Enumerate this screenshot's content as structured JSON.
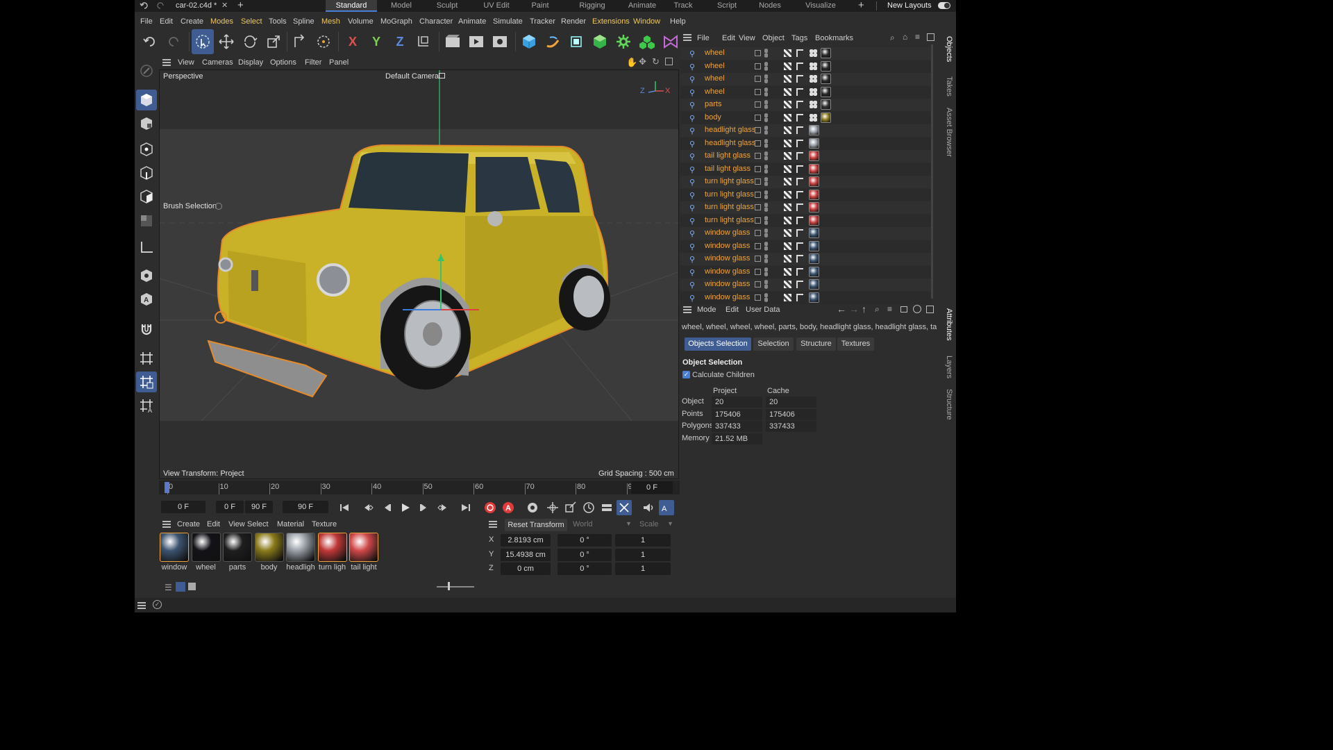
{
  "layoutbar": {
    "doc_title": "car-02.c4d *",
    "tabs": [
      "Standard",
      "Model",
      "Sculpt",
      "UV Edit",
      "Paint",
      "Rigging",
      "Animate",
      "Track",
      "Script",
      "Nodes",
      "Visualize"
    ],
    "active_tab": "Standard",
    "new_layouts": "New Layouts"
  },
  "menubar": [
    "File",
    "Edit",
    "Create",
    "Modes",
    "Select",
    "Tools",
    "Spline",
    "Mesh",
    "Volume",
    "MoGraph",
    "Character",
    "Animate",
    "Simulate",
    "Tracker",
    "Render",
    "Extensions",
    "Window",
    "Help"
  ],
  "menubar_highlight": [
    "Modes",
    "Select",
    "Mesh",
    "Extensions",
    "Window"
  ],
  "toolbar_icons": [
    "undo-icon",
    "redo-icon",
    "live-selection-icon",
    "move-icon",
    "rotate-icon",
    "scale-icon",
    "transfer-icon",
    "dynamic-place-icon",
    "x-axis-icon",
    "y-axis-icon",
    "z-axis-icon",
    "coordinate-system-icon",
    "render-view-icon",
    "render-picture-viewer-icon",
    "render-settings-icon",
    "cube-icon",
    "bend-icon",
    "subdivide-icon",
    "polygon-icon",
    "cloner-icon",
    "generator-icon",
    "spline-pen-icon"
  ],
  "toolbar_axis_labels": [
    "X",
    "Y",
    "Z"
  ],
  "left_tools": [
    "brush-icon",
    "model-mode-icon",
    "texture-mode-icon",
    "point-mode-icon",
    "edge-mode-icon",
    "polygon-mode-icon",
    "uv-mode-icon",
    "axis-mode-icon",
    "solo-icon",
    "auto-snap-icon",
    "magnet-icon",
    "workplane-icon",
    "grid-snap-icon",
    "quantize-icon"
  ],
  "viewport": {
    "menu": [
      "View",
      "Cameras",
      "Display",
      "Options",
      "Filter",
      "Panel"
    ],
    "projection": "Perspective",
    "camera": "Default Camera",
    "brush_selection": "Brush Selection",
    "view_transform": "View Transform: Project",
    "grid_spacing": "Grid Spacing : 500 cm",
    "axis_z": "Z",
    "axis_x": "X"
  },
  "timeline": {
    "ticks": [
      "0",
      "10",
      "20",
      "30",
      "40",
      "50",
      "60",
      "70",
      "80",
      "90"
    ],
    "current_frame_display": "0 F",
    "frame_field": "0 F",
    "range_start": "0 F",
    "range_end": "90 F",
    "range_end2": "90 F"
  },
  "materials": {
    "menu": [
      "Create",
      "Edit",
      "View",
      "Select",
      "Material",
      "Texture"
    ],
    "items": [
      {
        "label": "window",
        "color": "#3c5470"
      },
      {
        "label": "wheel",
        "color": "#121218"
      },
      {
        "label": "parts",
        "color": "#1e1e1e"
      },
      {
        "label": "body",
        "color": "#8a7a1a"
      },
      {
        "label": "headligh",
        "color": "#9aa0a8"
      },
      {
        "label": "turn ligh",
        "color": "#c03838"
      },
      {
        "label": "tail light",
        "color": "#d04848"
      }
    ]
  },
  "coords": {
    "reset_transform": "Reset Transform",
    "space": "World",
    "scale_mode": "Scale",
    "rows": [
      {
        "axis": "X",
        "pos": "2.8193 cm",
        "rot": "0 °",
        "scale": "1"
      },
      {
        "axis": "Y",
        "pos": "15.4938 cm",
        "rot": "0 °",
        "scale": "1"
      },
      {
        "axis": "Z",
        "pos": "0 cm",
        "rot": "0 °",
        "scale": "1"
      }
    ]
  },
  "object_manager": {
    "menu": [
      "File",
      "Edit",
      "View",
      "Object",
      "Tags",
      "Bookmarks"
    ],
    "objects": [
      {
        "name": "wheel",
        "tag": "#2a2a2a"
      },
      {
        "name": "wheel",
        "tag": "#2a2a2a"
      },
      {
        "name": "wheel",
        "tag": "#2a2a2a"
      },
      {
        "name": "wheel",
        "tag": "#2a2a2a"
      },
      {
        "name": "parts",
        "tag": "#333"
      },
      {
        "name": "body",
        "tag": "#8a7a1a"
      },
      {
        "name": "headlight glass",
        "tag": "#9aa0a8"
      },
      {
        "name": "headlight glass",
        "tag": "#9aa0a8"
      },
      {
        "name": "tail light glass",
        "tag": "#c94040"
      },
      {
        "name": "tail light glass",
        "tag": "#c94040"
      },
      {
        "name": "turn light glass",
        "tag": "#c94040"
      },
      {
        "name": "turn light glass",
        "tag": "#c94040"
      },
      {
        "name": "turn light glass",
        "tag": "#c94040"
      },
      {
        "name": "turn light glass",
        "tag": "#c94040"
      },
      {
        "name": "window glass",
        "tag": "#3c5470"
      },
      {
        "name": "window glass",
        "tag": "#3c5470"
      },
      {
        "name": "window glass",
        "tag": "#3c5470"
      },
      {
        "name": "window glass",
        "tag": "#3c5470"
      },
      {
        "name": "window glass",
        "tag": "#3c5470"
      },
      {
        "name": "window glass",
        "tag": "#3c5470"
      }
    ]
  },
  "attributes": {
    "menu": [
      "Mode",
      "Edit",
      "User Data"
    ],
    "selection_summary": "wheel, wheel, wheel, wheel, parts, body, headlight glass, headlight glass, tail light",
    "tabs": [
      "Objects Selection",
      "Selection",
      "Structure",
      "Textures"
    ],
    "section_title": "Object Selection",
    "calculate_children": "Calculate Children",
    "col_project": "Project",
    "col_cache": "Cache",
    "rows": [
      {
        "label": "Object",
        "project": "20",
        "cache": "20"
      },
      {
        "label": "Points",
        "project": "175406",
        "cache": "175406"
      },
      {
        "label": "Polygons",
        "project": "337433",
        "cache": "337433"
      },
      {
        "label": "Memory",
        "project": "21.52 MB",
        "cache": ""
      }
    ]
  },
  "side_tabs": [
    "Objects",
    "Takes",
    "Asset Browser",
    "Attributes",
    "Layers",
    "Structure"
  ],
  "accent": "#3f5d93",
  "highlight_menu_color": "#f0c95c",
  "object_name_color": "#f0a43a"
}
